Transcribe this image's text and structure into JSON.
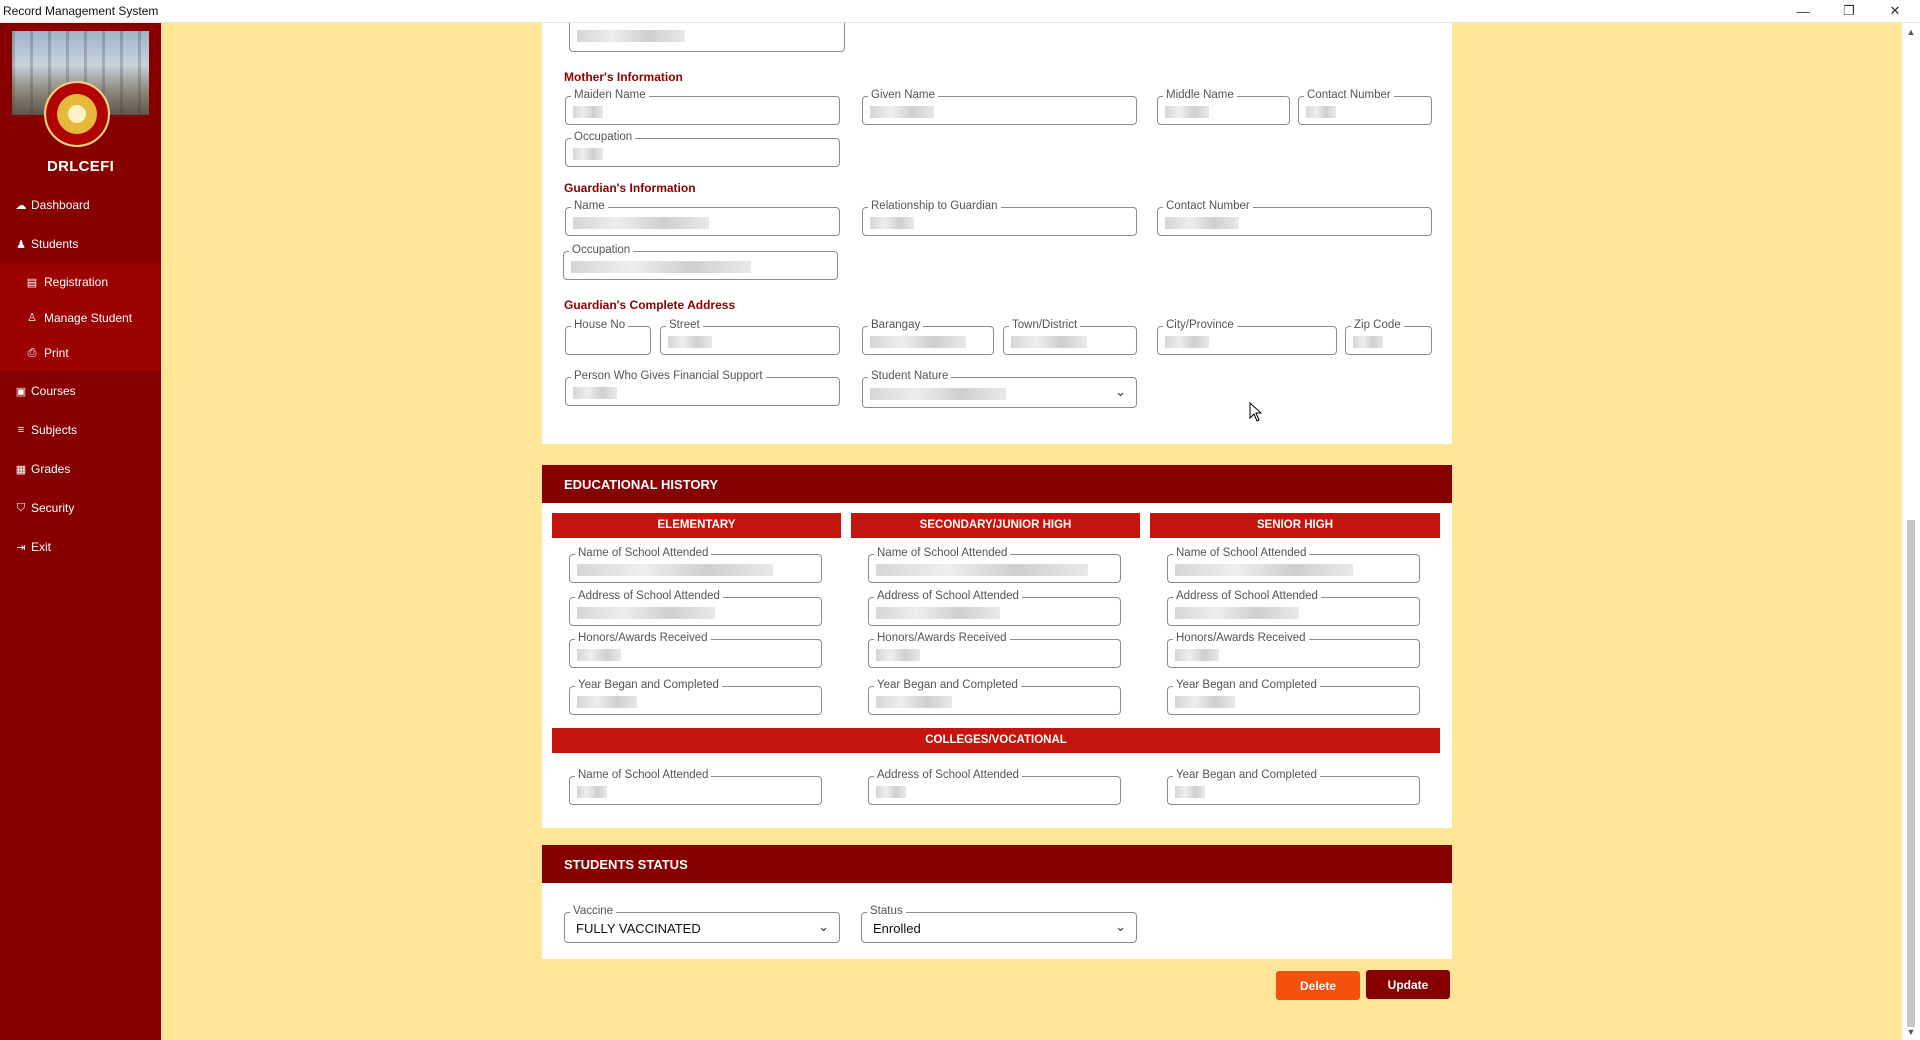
{
  "window": {
    "title": "Record Management System",
    "minimize": "—",
    "restore": "❐",
    "close": "✕"
  },
  "sidebar": {
    "brand": "DRLCEFI",
    "items": [
      {
        "label": "Dashboard",
        "icon": "dashboard-icon",
        "glyph": "☁"
      },
      {
        "label": "Students",
        "icon": "user-icon",
        "glyph": "♟"
      },
      {
        "label": "Registration",
        "icon": "form-icon",
        "glyph": "▤"
      },
      {
        "label": "Manage Student",
        "icon": "user-edit-icon",
        "glyph": "♙"
      },
      {
        "label": "Print",
        "icon": "printer-icon",
        "glyph": "⎙"
      },
      {
        "label": "Courses",
        "icon": "book-icon",
        "glyph": "▣"
      },
      {
        "label": "Subjects",
        "icon": "list-icon",
        "glyph": "≡"
      },
      {
        "label": "Grades",
        "icon": "report-icon",
        "glyph": "▦"
      },
      {
        "label": "Security",
        "icon": "shield-icon",
        "glyph": "⛉"
      },
      {
        "label": "Exit",
        "icon": "exit-icon",
        "glyph": "⇥"
      }
    ]
  },
  "mother": {
    "title": "Mother's Information",
    "maiden_name": "Maiden Name",
    "given_name": "Given Name",
    "middle_name": "Middle Name",
    "contact_number": "Contact Number",
    "occupation": "Occupation"
  },
  "guardian": {
    "title": "Guardian's Information",
    "name": "Name",
    "relationship": "Relationship to Guardian",
    "contact_number": "Contact Number",
    "occupation": "Occupation"
  },
  "address": {
    "title": "Guardian's Complete Address",
    "house_no": "House No",
    "street": "Street",
    "barangay": "Barangay",
    "town": "Town/District",
    "city": "City/Province",
    "zip": "Zip Code",
    "financial_support": "Person Who Gives Financial Support",
    "student_nature": "Student Nature"
  },
  "education": {
    "title": "EDUCATIONAL HISTORY",
    "elementary": "ELEMENTARY",
    "secondary": "SECONDARY/JUNIOR HIGH",
    "senior": "SENIOR HIGH",
    "college": "COLLEGES/VOCATIONAL",
    "school_name": "Name of School Attended",
    "school_address": "Address of School Attended",
    "honors": "Honors/Awards Received",
    "years": "Year Began and Completed"
  },
  "status": {
    "title": "STUDENTS STATUS",
    "vaccine_label": "Vaccine",
    "vaccine_value": "FULLY VACCINATED",
    "status_label": "Status",
    "status_value": "Enrolled"
  },
  "actions": {
    "delete": "Delete",
    "update": "Update"
  },
  "colors": {
    "sidebar": "#870000",
    "background": "#ffe597",
    "header_red": "#c3150e",
    "delete": "#f4510f",
    "update": "#870000"
  }
}
